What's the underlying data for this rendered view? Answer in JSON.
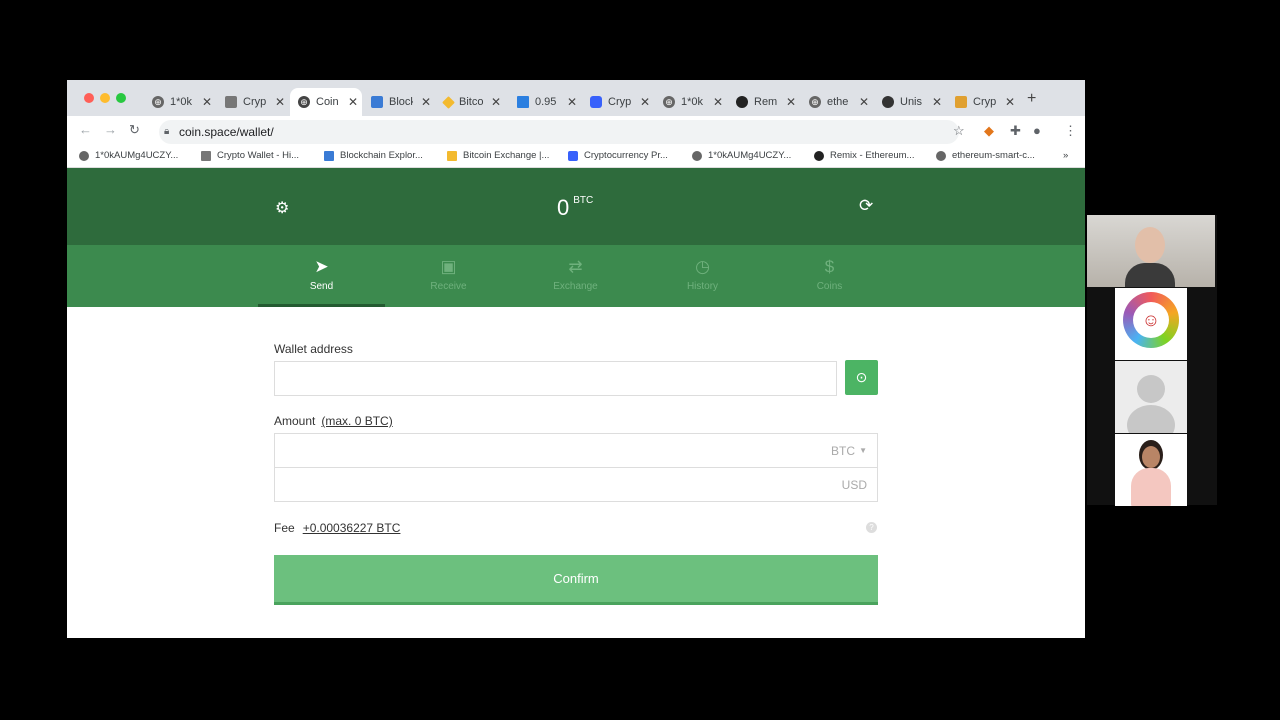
{
  "browser": {
    "tabs": [
      {
        "title": "1*0k",
        "icon": "globe-icon"
      },
      {
        "title": "Cryp",
        "icon": "wallet-icon"
      },
      {
        "title": "Coin",
        "icon": "globe-icon",
        "active": true
      },
      {
        "title": "Block",
        "icon": "blockchain-icon"
      },
      {
        "title": "Bitco",
        "icon": "binance-icon"
      },
      {
        "title": "0.95",
        "icon": "chart-icon"
      },
      {
        "title": "Cryp",
        "icon": "coinmarketcap-icon"
      },
      {
        "title": "1*0k",
        "icon": "globe-icon"
      },
      {
        "title": "Rem",
        "icon": "remix-icon"
      },
      {
        "title": "ethe",
        "icon": "globe-icon"
      },
      {
        "title": "Unis",
        "icon": "github-icon"
      },
      {
        "title": "Cryp",
        "icon": "crypto-icon"
      }
    ],
    "url": "coin.space/wallet/",
    "bookmarks": [
      {
        "label": "1*0kAUMg4UCZY...",
        "icon": "globe-icon"
      },
      {
        "label": "Crypto Wallet - Hi...",
        "icon": "wallet-icon"
      },
      {
        "label": "Blockchain Explor...",
        "icon": "blockchain-icon"
      },
      {
        "label": "Bitcoin Exchange |...",
        "icon": "binance-icon"
      },
      {
        "label": "Cryptocurrency Pr...",
        "icon": "coinmarketcap-icon"
      },
      {
        "label": "1*0kAUMg4UCZY...",
        "icon": "globe-icon"
      },
      {
        "label": "Remix - Ethereum...",
        "icon": "remix-icon"
      },
      {
        "label": "ethereum-smart-c...",
        "icon": "globe-icon"
      }
    ],
    "bookmarks_more": "»"
  },
  "wallet": {
    "balance": "0",
    "currency": "BTC"
  },
  "nav": [
    {
      "label": "Send",
      "icon": "send-icon",
      "active": true
    },
    {
      "label": "Receive",
      "icon": "inbox-icon"
    },
    {
      "label": "Exchange",
      "icon": "exchange-icon"
    },
    {
      "label": "History",
      "icon": "clock-icon"
    },
    {
      "label": "Coins",
      "icon": "coin-icon"
    }
  ],
  "form": {
    "wallet_address_label": "Wallet address",
    "wallet_address_value": "",
    "amount_label": "Amount",
    "max_link": "(max. 0 BTC)",
    "amount_crypto_unit": "BTC",
    "amount_fiat_unit": "USD",
    "fee_label": "Fee",
    "fee_value": "+0.00036227 BTC",
    "confirm_label": "Confirm"
  },
  "colors": {
    "header": "#2e6b3c",
    "nav": "#3c8a4e",
    "confirm": "#6cc07e",
    "qr_button": "#4cb464"
  }
}
